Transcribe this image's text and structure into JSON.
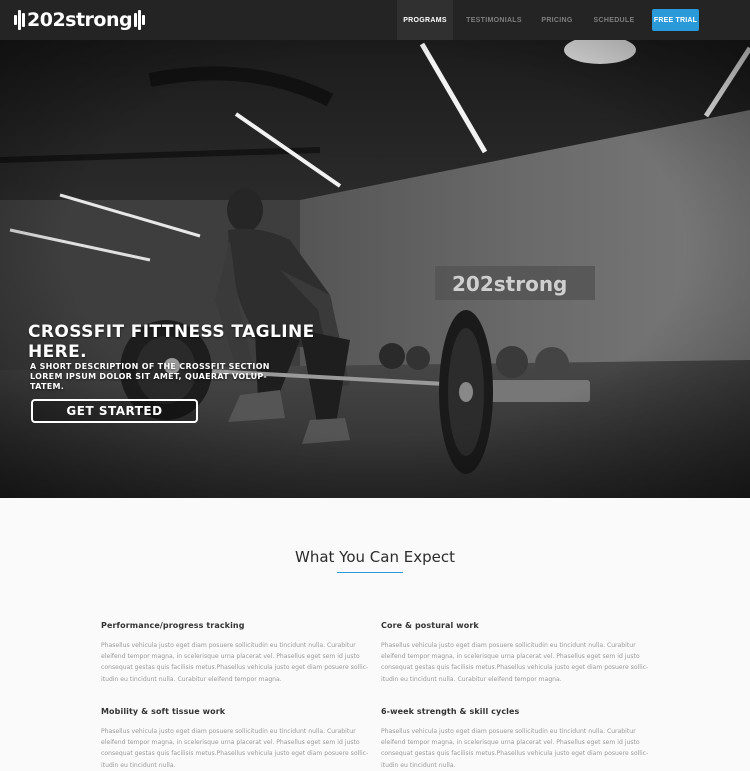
{
  "brand": {
    "name": "202strong"
  },
  "nav": {
    "items": [
      {
        "label": "PROGRAMS",
        "active": true
      },
      {
        "label": "TESTIMONIALS",
        "active": false
      },
      {
        "label": "PRICING",
        "active": false
      },
      {
        "label": "SCHEDULE",
        "active": false
      }
    ],
    "cta_label": "FREE TRIAL"
  },
  "hero": {
    "title": "CROSSFIT FITTNESS TAGLINE HERE.",
    "description": "A SHORT DESCRIPTION OF THE CROSSFIT SECTION LOREM IPSUM DOLOR SIT AMET, QUAERAT VOLUP-TATEM.",
    "button_label": "GET STARTED",
    "wall_logo_text": "202strong"
  },
  "section": {
    "title": "What You Can Expect"
  },
  "features": [
    {
      "title": "Performance/progress tracking",
      "text": "Phasellus vehicula justo eget diam posuere sollicitudin eu tincidunt nulla. Curabitur eleifend tempor magna, in scelerisque urna placerat vel. Phasellus eget sem id justo consequat gestas quis facilisis metus.Phasellus vehicula justo eget diam posuere sollic-itudin eu tincidunt nulla. Curabitur eleifend tempor magna."
    },
    {
      "title": "Core & postural work",
      "text": "Phasellus vehicula justo eget diam posuere sollicitudin eu tincidunt nulla. Curabitur eleifend tempor magna, in scelerisque urna placerat vel. Phasellus eget sem id justo consequat gestas quis facilisis metus.Phasellus vehicula justo eget diam posuere sollic-itudin eu tincidunt nulla. Curabitur eleifend tempor magna."
    },
    {
      "title": "Mobility & soft tissue work",
      "text": "Phasellus vehicula justo eget diam posuere sollicitudin eu tincidunt nulla. Curabitur eleifend tempor magna, in scelerisque urna placerat vel. Phasellus eget sem id justo consequat gestas quis facilisis metus.Phasellus vehicula justo eget diam posuere sollic-itudin eu tincidunt nulla."
    },
    {
      "title": "6-week strength & skill cycles",
      "text": "Phasellus vehicula justo eget diam posuere sollicitudin eu tincidunt nulla. Curabitur eleifend tempor magna, in scelerisque urna placerat vel. Phasellus eget sem id justo consequat gestas quis facilisis metus.Phasellus vehicula justo eget diam posuere sollic-itudin eu tincidunt nulla."
    }
  ],
  "colors": {
    "nav_bg": "#242424",
    "accent": "#2b9ad9",
    "page_bg": "#fafafa"
  }
}
